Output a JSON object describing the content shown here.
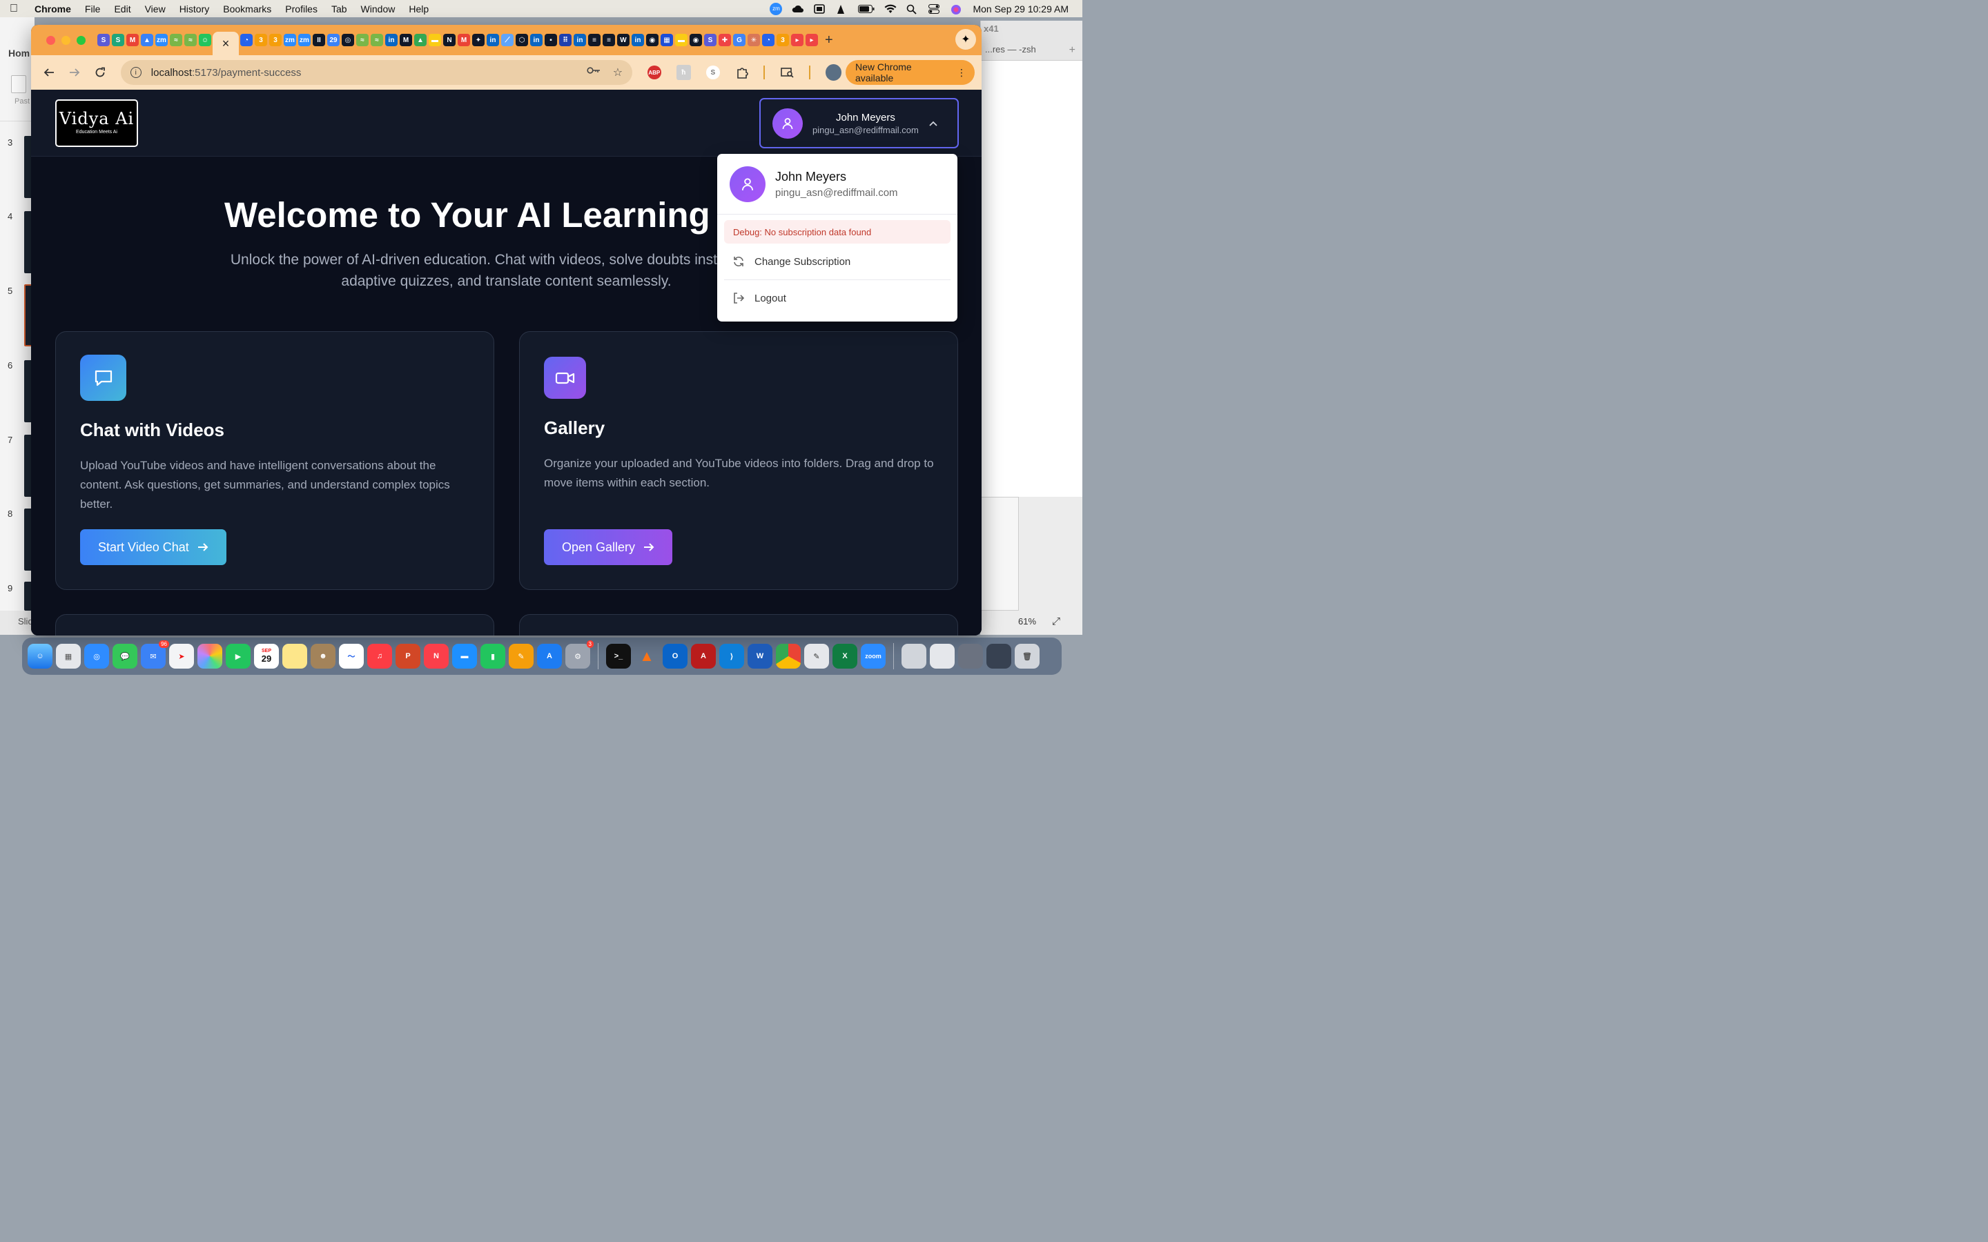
{
  "menubar": {
    "app_name": "Chrome",
    "items": [
      "File",
      "Edit",
      "View",
      "History",
      "Bookmarks",
      "Profiles",
      "Tab",
      "Window",
      "Help"
    ],
    "clock": "Mon Sep 29  10:29 AM"
  },
  "background": {
    "left_app_title": "Hom",
    "left_app_paste": "Past",
    "slide_numbers": [
      "3",
      "4",
      "5",
      "6",
      "7",
      "8",
      "9"
    ],
    "left_bottom_label": "Slid",
    "terminal_tab": "...res — -zsh",
    "terminal_title": "x41",
    "zoom_level": "61%"
  },
  "browser": {
    "active_tab_close": "×",
    "new_tab": "+",
    "url_host": "localhost",
    "url_path": ":5173/payment-success",
    "update_button": "New Chrome available",
    "tab_icons": [
      {
        "label": "S",
        "color": "#5b5bd6"
      },
      {
        "label": "S",
        "color": "#1fa67a"
      },
      {
        "label": "M",
        "color": "#ea4335"
      },
      {
        "label": "▲",
        "color": "#3b82f6"
      },
      {
        "label": "zm",
        "color": "#2d8cff"
      },
      {
        "label": "≈",
        "color": "#7ab648"
      },
      {
        "label": "≈",
        "color": "#7ab648"
      },
      {
        "label": "☺",
        "color": "#22c55e"
      },
      {
        "label": "◔",
        "color": "#2563eb"
      },
      {
        "label": "3",
        "color": "#f59e0b"
      },
      {
        "label": "3",
        "color": "#f59e0b"
      },
      {
        "label": "zm",
        "color": "#2d8cff"
      },
      {
        "label": "zm",
        "color": "#2d8cff"
      },
      {
        "label": "II",
        "color": "#111827"
      },
      {
        "label": "29",
        "color": "#3b82f6"
      },
      {
        "label": "◎",
        "color": "#111827"
      },
      {
        "label": "≈",
        "color": "#7ab648"
      },
      {
        "label": "≈",
        "color": "#7ab648"
      },
      {
        "label": "in",
        "color": "#0a66c2"
      },
      {
        "label": "M",
        "color": "#111827"
      },
      {
        "label": "▲",
        "color": "#34a853"
      },
      {
        "label": "▬",
        "color": "#facc15"
      },
      {
        "label": "N",
        "color": "#111827"
      },
      {
        "label": "M",
        "color": "#ea4335"
      },
      {
        "label": "✦",
        "color": "#111827"
      },
      {
        "label": "in",
        "color": "#0a66c2"
      },
      {
        "label": "⟋",
        "color": "#60a5fa"
      },
      {
        "label": "⬡",
        "color": "#111827"
      },
      {
        "label": "in",
        "color": "#0a66c2"
      },
      {
        "label": "▪",
        "color": "#111827"
      },
      {
        "label": "⠿",
        "color": "#1e40af"
      },
      {
        "label": "in",
        "color": "#0a66c2"
      },
      {
        "label": "≡",
        "color": "#111827"
      },
      {
        "label": "≡",
        "color": "#111827"
      },
      {
        "label": "W",
        "color": "#111827"
      },
      {
        "label": "in",
        "color": "#0a66c2"
      },
      {
        "label": "◉",
        "color": "#111827"
      },
      {
        "label": "▦",
        "color": "#1d4ed8"
      },
      {
        "label": "▬",
        "color": "#facc15"
      },
      {
        "label": "◉",
        "color": "#111827"
      },
      {
        "label": "S",
        "color": "#5b5bd6"
      },
      {
        "label": "✚",
        "color": "#ef4444"
      },
      {
        "label": "G",
        "color": "#4285f4"
      },
      {
        "label": "✳",
        "color": "#d97757"
      },
      {
        "label": "◔",
        "color": "#2563eb"
      },
      {
        "label": "3",
        "color": "#f59e0b"
      },
      {
        "label": "▸",
        "color": "#ef4444"
      },
      {
        "label": "▸",
        "color": "#ef4444"
      }
    ],
    "extensions": [
      {
        "label": "ABP",
        "name": "adblock-icon"
      },
      {
        "label": "ħ",
        "name": "extension-h-icon"
      },
      {
        "label": "S",
        "name": "extension-s-icon"
      }
    ]
  },
  "app": {
    "logo_name": "Vidya Ai",
    "logo_tagline": "Education Meets Ai",
    "user": {
      "name": "John Meyers",
      "email": "pingu_asn@rediffmail.com"
    },
    "hero": {
      "title": "Welcome to Your AI Learning Hub",
      "subtitle": "Unlock the power of AI-driven education. Chat with videos, solve doubts instantly, take adaptive quizzes, and translate content seamlessly."
    },
    "cards": [
      {
        "title": "Chat with Videos",
        "description": "Upload YouTube videos and have intelligent conversations about the content. Ask questions, get summaries, and understand complex topics better.",
        "button": "Start Video Chat",
        "gradient_from": "#3b82f6",
        "gradient_to": "#44b6d8"
      },
      {
        "title": "Gallery",
        "description": "Organize your uploaded and YouTube videos into folders. Drag and drop to move items within each section.",
        "button": "Open Gallery",
        "gradient_from": "#6366f1",
        "gradient_to": "#9b50e8"
      }
    ],
    "dropdown": {
      "debug_message": "Debug: No subscription data found",
      "change_subscription": "Change Subscription",
      "logout": "Logout"
    }
  },
  "dock": {
    "mail_badge": "96",
    "calendar_month": "SEP",
    "calendar_day": "29",
    "settings_badge": "3",
    "zoom_label": "zoom"
  }
}
